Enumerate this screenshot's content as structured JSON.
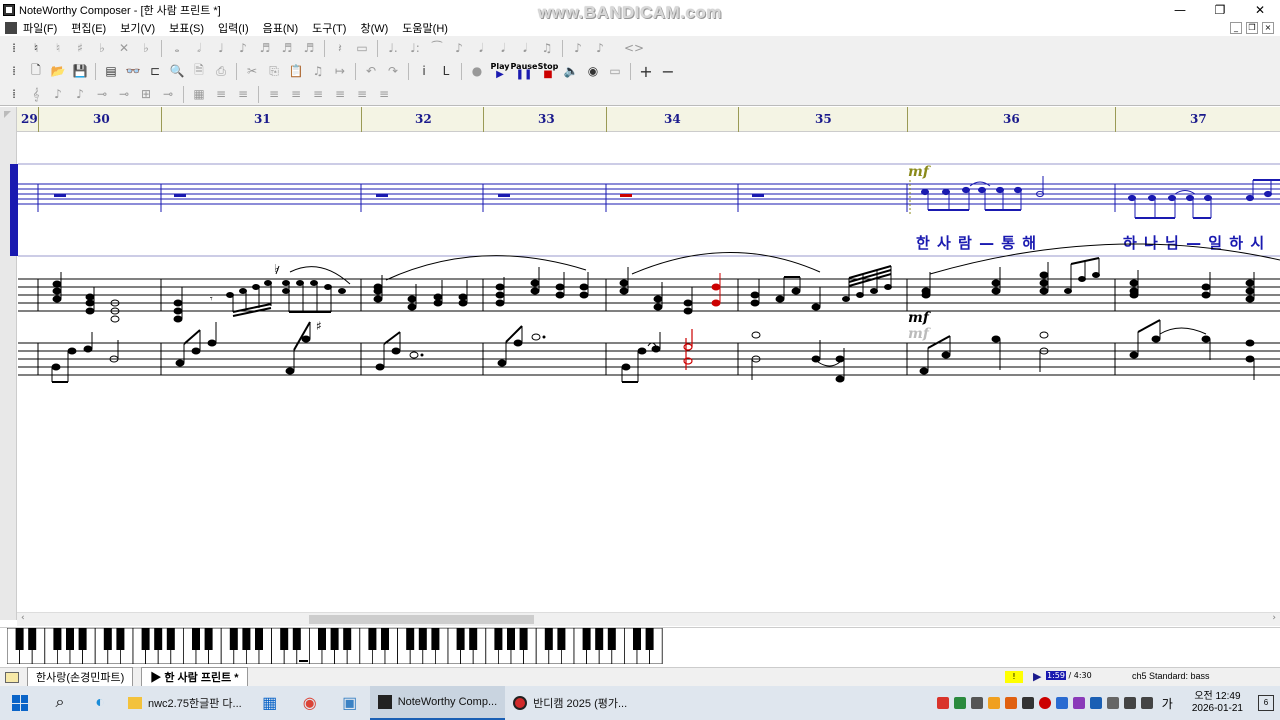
{
  "window": {
    "title": "NoteWorthy Composer - [한 사람 프린트 *]",
    "watermark": "www.BANDICAM.com",
    "controls": {
      "minimize": "—",
      "maximize": "❐",
      "close": "✕"
    }
  },
  "menu": {
    "items": [
      "파일(F)",
      "편집(E)",
      "보기(V)",
      "보표(S)",
      "입력(I)",
      "음표(N)",
      "도구(T)",
      "창(W)",
      "도움말(H)"
    ]
  },
  "toolbar": {
    "play_label": "Play",
    "pause_label": "Pause",
    "stop_label": "Stop"
  },
  "ruler": {
    "bars": [
      "29",
      "30",
      "31",
      "32",
      "33",
      "34",
      "35",
      "36",
      "37"
    ]
  },
  "score": {
    "dynamic_mark": "mf",
    "lyrics_part1": "한 사 람 — 통 해",
    "lyrics_part2": "하 나 님 — 일 하 시"
  },
  "tabs": {
    "staff1": "한사랑(손경민파트)",
    "staff2": "한 사람 프린트 *"
  },
  "status": {
    "warn": "!",
    "time_current": "1:59",
    "time_total": " / 4:30",
    "channel": "ch5 Standard: bass"
  },
  "taskbar": {
    "apps": [
      {
        "label": "nwc2.75한글판 다..."
      },
      {
        "label": "NoteWorthy Comp..."
      },
      {
        "label": "반디캠 2025 (평가..."
      }
    ],
    "lang": "가",
    "time": "오전 12:49",
    "date": "2026-01-21",
    "notif_count": "6"
  },
  "colors": {
    "staff_blue": "#1a1ab0",
    "selection_red": "#cc0000",
    "ruler_bg": "#f4f4e4",
    "dynamic_olive": "#8a8a1a"
  }
}
